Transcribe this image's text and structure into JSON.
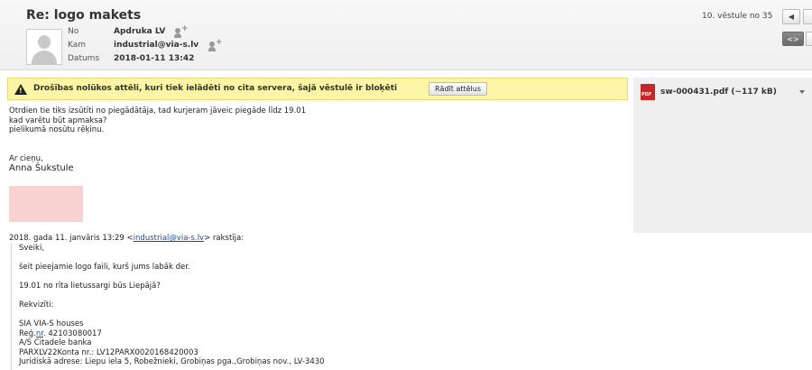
{
  "header": {
    "subject": "Re: logo makets",
    "from_label": "No",
    "from_value": "Apdruka LV",
    "to_label": "Kam",
    "to_value": "industrial@via-s.lv",
    "date_label": "Datums",
    "date_value": "2018-01-11 13:42",
    "thread_counter": "10. vēstule no 35",
    "prev_icon": "◀",
    "toggle_icon": "<>"
  },
  "warning": {
    "text": "Drošības nolūkos attēli, kuri tiek ielādēti no cita servera, šajā vēstulē ir bloķēti",
    "button_label": "Rādīt attēlus"
  },
  "body": {
    "lines": [
      "Otrdien tie tiks izsūtīti no piegādātāja, tad kurjeram jāveic piegāde līdz 19.01",
      "kad varētu būt apmaksa?",
      "pielikumā nosūtu rēķinu."
    ],
    "closing": "Ar cieņu,",
    "signature": "Anna Šukstule"
  },
  "quote": {
    "header_prefix": "2018. gada 11. janvāris 13:29 <",
    "header_email": "industrial@via-s.lv",
    "header_suffix": "> rakstīja:",
    "greeting": "Sveiki,",
    "line1": "šeit pieejamie logo faili, kurš jums labāk der.",
    "line2": "19.01 no rīta lietussargi būs Liepājā?",
    "rekviziti": "Rekvizīti:",
    "company": "SIA VIA-S houses",
    "reg_prefix": "Reģ.",
    "reg_link": "nr",
    "reg_suffix": ". 42103080017",
    "bank": "A/S Citadele banka",
    "account": "PARXLV22Konta nr.: LV12PARX0020168420003",
    "address": "Juridiskā adrese: Liepu iela 5, Robežnieki, Grobiņas pga.,Grobiņas nov., LV-3430"
  },
  "attachment": {
    "icon_text": "PDF",
    "name": "sw-000431.pdf (~117 kB)"
  }
}
